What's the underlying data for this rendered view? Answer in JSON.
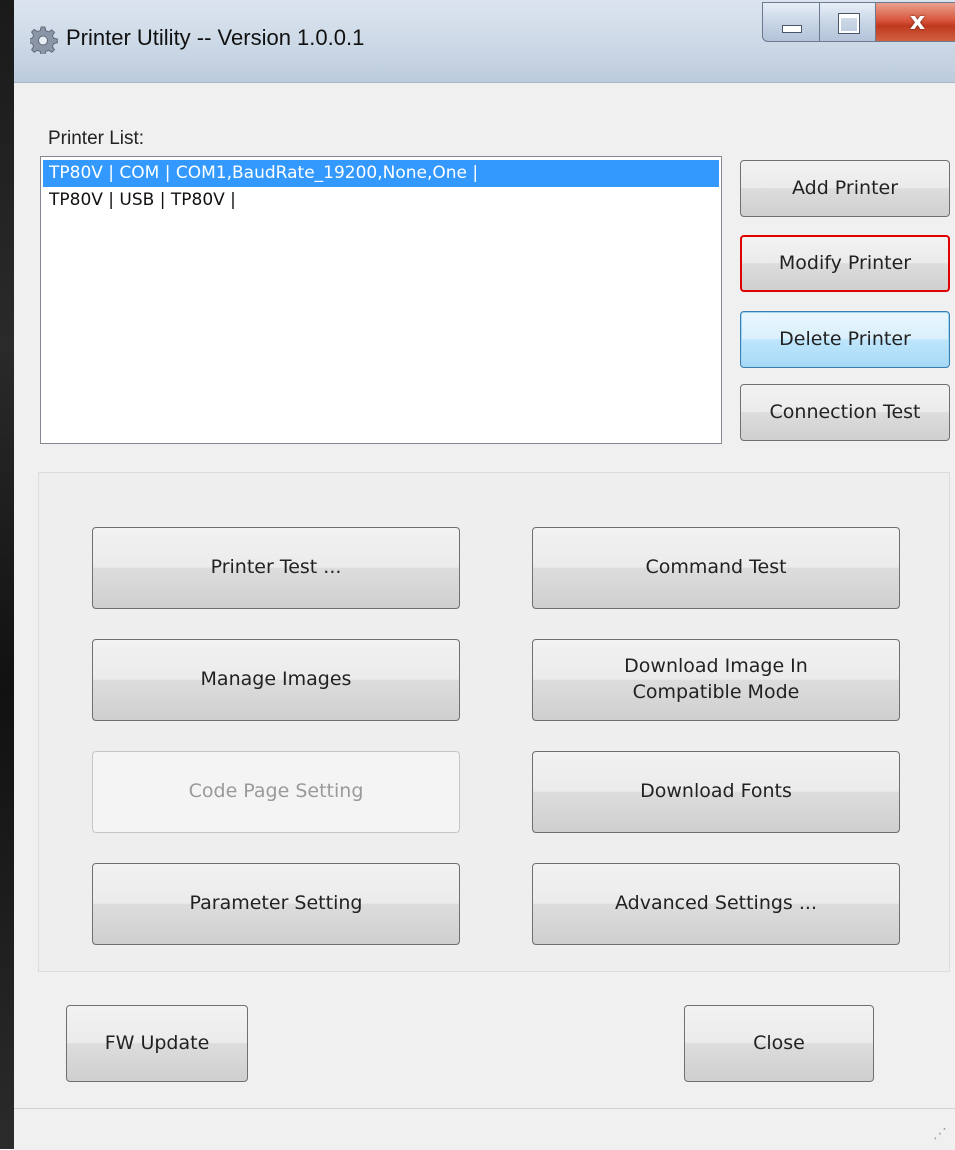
{
  "window": {
    "title": "Printer Utility -- Version 1.0.0.1",
    "icon": "gear-icon",
    "caption_buttons": {
      "minimize": "minimize-icon",
      "maximize": "maximize-icon",
      "close_glyph": "x"
    }
  },
  "printer_list": {
    "label": "Printer List:",
    "items": [
      {
        "text": "TP80V | COM | COM1,BaudRate_19200,None,One |",
        "selected": true
      },
      {
        "text": "TP80V | USB | TP80V |",
        "selected": false
      }
    ]
  },
  "side_buttons": {
    "add": "Add Printer",
    "modify": "Modify Printer",
    "delete": "Delete Printer",
    "connection_test": "Connection Test"
  },
  "functions": {
    "printer_test": "Printer Test ...",
    "command_test": "Command Test",
    "manage_images": "Manage Images",
    "download_image_line1": "Download Image In",
    "download_image_line2": "Compatible Mode",
    "code_page_setting": "Code Page Setting",
    "download_fonts": "Download Fonts",
    "parameter_setting": "Parameter Setting",
    "advanced_settings": "Advanced Settings ..."
  },
  "bottom_buttons": {
    "fw_update": "FW Update",
    "close": "Close"
  },
  "colors": {
    "selection": "#3399ff",
    "highlight_border": "#e00000",
    "close_button": "#c0391f"
  }
}
